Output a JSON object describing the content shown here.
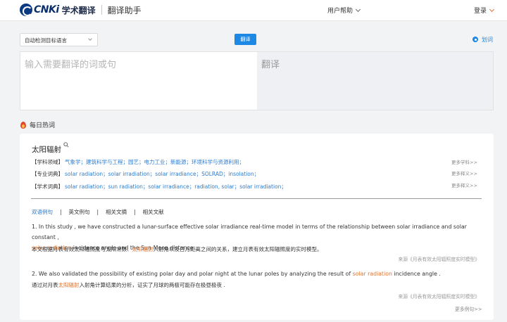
{
  "header": {
    "logo_text": "CNKi",
    "logo_cn": "学术翻译",
    "subtitle": "翻译助手",
    "help": "用户帮助",
    "login": "登录"
  },
  "toolbar": {
    "lang_select": "自动检测目标语言",
    "translate_btn": "翻译",
    "radio_label": "划词"
  },
  "panes": {
    "input_placeholder": "输入需要翻译的词或句",
    "output_placeholder": "翻译"
  },
  "hot": {
    "title": "每日热词",
    "term": "太阳辐射",
    "rows": [
      {
        "label": "【学科领域】",
        "values": "气象学；建筑科学与工程；园艺；电力工业；新能源；环境科学与资源利用；",
        "more": "更多学科>>"
      },
      {
        "label": "【专业词典】",
        "values": "solar radiation；solar irradiation；solar irradiance；SOLRAD；insolation；",
        "more": "更多释义>>"
      },
      {
        "label": "【学术词典】",
        "values": "solar radiation；sun radiation；solar irradiance；radiation, solar；solar irradiation；",
        "more": "更多释义>>"
      }
    ],
    "tabs": [
      "双语例句",
      "英文例句",
      "相关文摘",
      "相关文献"
    ],
    "examples": [
      {
        "en_pre": "1. In this study , we have constructed a lunar-surface effective solar irradiance real-time model in terms of the relationship between solar irradiance and solar constant ,",
        "en_hl": "solar radiation",
        "en_post": " incidence angle and the Sun-Moon distance .",
        "cn_pre": "本文根据月表有效太阳辐照度与太阳常数、",
        "cn_hl": "太阳辐射",
        "cn_post": "入射角以及日月距离之间的关系，建立月表有效太阳辐照度的实时模型。",
        "source": "来源《月表有效太阳辐照度实时模型》"
      },
      {
        "en_pre": "2. We also validated the possibility of existing polar day and polar night at the lunar poles by analyzing the result of ",
        "en_hl": "solar radiation",
        "en_post": " incidence angle .",
        "cn_pre": "通过对月表",
        "cn_hl": "太阳辐射",
        "cn_post": "入射角计算结果的分析，证实了月球的两极可能存在极昼极夜 .",
        "source": "来源《月表有效太阳辐照度实时模型》"
      }
    ],
    "more_examples": "更多例句>>"
  }
}
